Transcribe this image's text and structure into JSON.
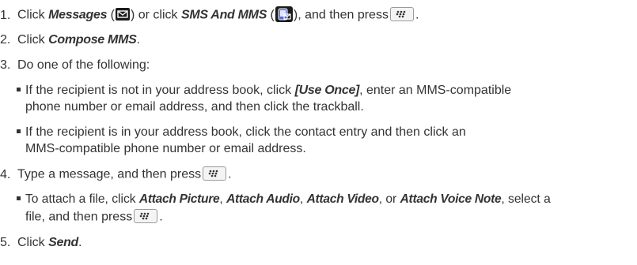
{
  "instructions": {
    "step1": {
      "num": "1.",
      "t1": "Click ",
      "messages": "Messages",
      "t2": " (",
      "t3": ") or click ",
      "sms": "SMS And MMS",
      "t4": " (",
      "t5": "), and then press",
      "t6": "."
    },
    "step2": {
      "num": "2.",
      "t1": "Click ",
      "compose": "Compose MMS",
      "t2": "."
    },
    "step3": {
      "num": "3.",
      "text": "Do one of the following:",
      "bullet1": {
        "t1": "If the recipient is not in your address book, click ",
        "useonce": "[Use Once]",
        "t2": ", enter an MMS-compatible",
        "line2": "phone number or email address, and then click the trackball."
      },
      "bullet2": {
        "line1": "If the recipient is in your address book, click the contact entry and then click an",
        "line2": "MMS-compatible phone number or email address."
      }
    },
    "step4": {
      "num": "4.",
      "t1": "Type a message, and then press",
      "t2": ".",
      "bullet": {
        "t1": "To attach a file, click ",
        "picture": "Attach Picture",
        "c1": ", ",
        "audio": "Attach Audio",
        "c2": ", ",
        "video": "Attach Video",
        "c3": ", or ",
        "voice": "Attach Voice Note",
        "t2": ", select a",
        "line2a": "file, and then press",
        "line2b": "."
      }
    },
    "step5": {
      "num": "5.",
      "t1": "Click ",
      "send": "Send",
      "t2": "."
    }
  },
  "icons": {
    "messages": "envelope-icon",
    "sms": "sms-mms-icon",
    "menu_key": "blackberry-menu-key-icon"
  }
}
